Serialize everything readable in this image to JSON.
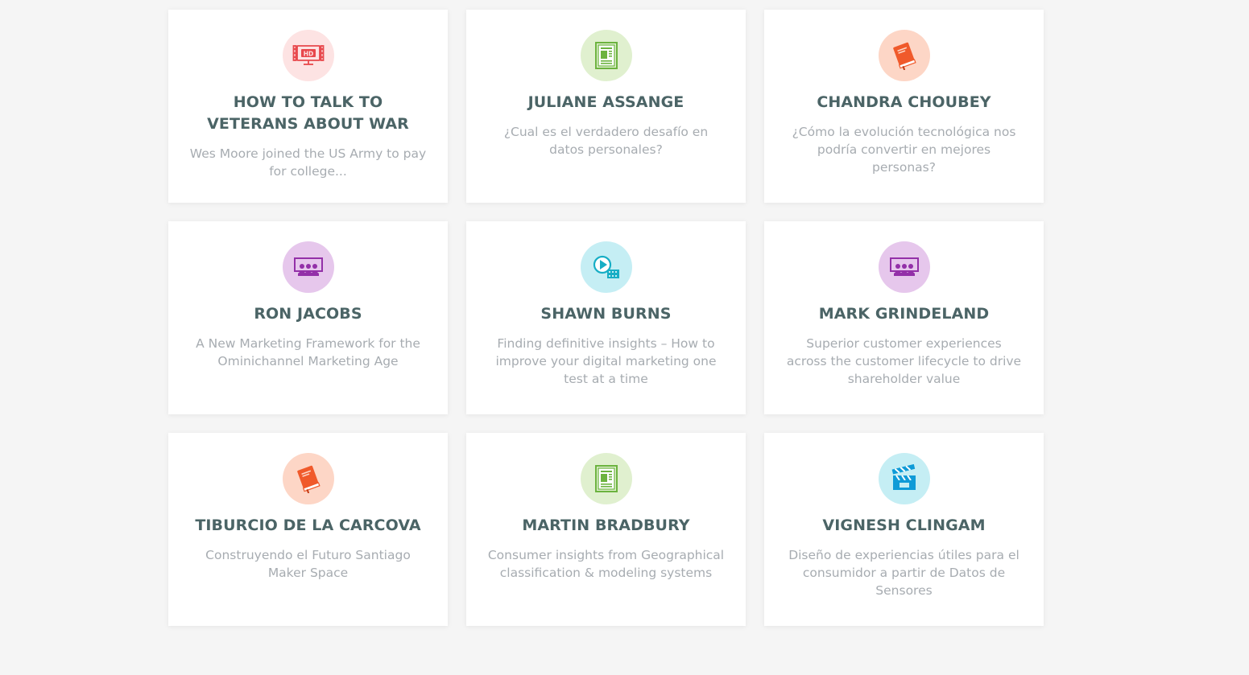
{
  "colors": {
    "page_background": "#f5f5f5",
    "card_background": "#ffffff",
    "title": "#4b6466",
    "description": "#a7acb1"
  },
  "cards": [
    {
      "title": "HOW TO TALK TO VETERANS ABOUT WAR",
      "description": "Wes Moore joined the US Army to pay for college...",
      "icon": "hd-video-icon",
      "icon_bg": "#fde3e3",
      "icon_color": "#e8484c"
    },
    {
      "title": "JULIANE ASSANGE",
      "description": "¿Cual es el verdadero desafío en datos personales?",
      "icon": "document-icon",
      "icon_bg": "#e0f0cf",
      "icon_color": "#6cb33f"
    },
    {
      "title": "CHANDRA CHOUBEY",
      "description": "¿Cómo la evolución tecnológica nos podría convertir en mejores personas?",
      "icon": "book-icon",
      "icon_bg": "#fdd6c6",
      "icon_color": "#f05a2b"
    },
    {
      "title": "RON JACOBS",
      "description": "A New Marketing Framework for the Ominichannel Marketing Age",
      "icon": "audience-icon",
      "icon_bg": "#e6c7ec",
      "icon_color": "#9330a8"
    },
    {
      "title": "SHAWN BURNS",
      "description": "Finding definitive insights –  How to improve your digital marketing one test at a time",
      "icon": "play-film-icon",
      "icon_bg": "#c5eef4",
      "icon_color": "#17aec5"
    },
    {
      "title": "MARK GRINDELAND",
      "description": "Superior customer experiences across the customer lifecycle to drive shareholder value",
      "icon": "audience-icon",
      "icon_bg": "#e6c7ec",
      "icon_color": "#9330a8"
    },
    {
      "title": "TIBURCIO DE LA CARCOVA",
      "description": "Construyendo el Futuro Santiago Maker Space",
      "icon": "book-icon",
      "icon_bg": "#fdd6c6",
      "icon_color": "#f05a2b"
    },
    {
      "title": "MARTIN BRADBURY",
      "description": "Consumer insights from Geographical classification & modeling systems",
      "icon": "document-icon",
      "icon_bg": "#e0f0cf",
      "icon_color": "#6cb33f"
    },
    {
      "title": "VIGNESH CLINGAM",
      "description": "Diseño de experiencias útiles para el consumidor a partir de Datos de Sensores",
      "icon": "clapperboard-icon",
      "icon_bg": "#c5eef4",
      "icon_color": "#0f9bd7"
    }
  ]
}
